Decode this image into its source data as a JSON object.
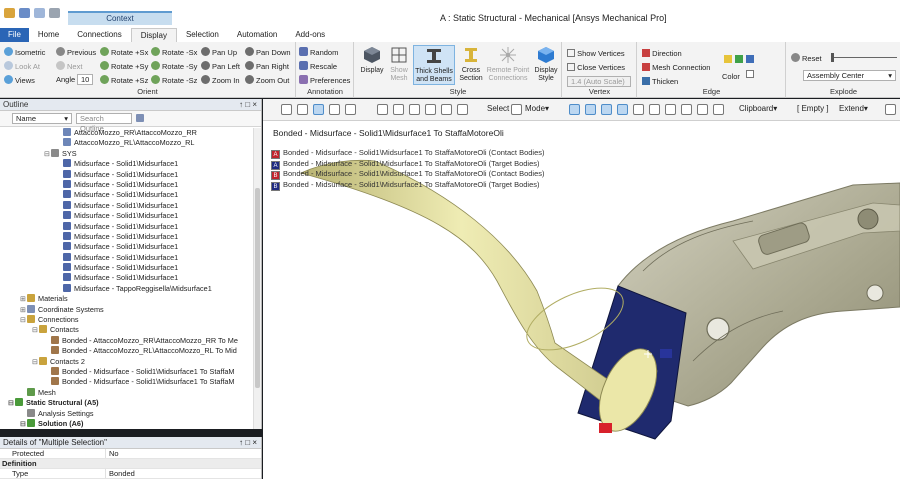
{
  "window": {
    "title": "A : Static Structural - Mechanical [Ansys Mechanical Pro]",
    "context_tab": "Context"
  },
  "tabs": [
    {
      "label": "File"
    },
    {
      "label": "Home"
    },
    {
      "label": "Connections"
    },
    {
      "label": "Display"
    },
    {
      "label": "Selection"
    },
    {
      "label": "Automation"
    },
    {
      "label": "Add-ons"
    }
  ],
  "ribbon": {
    "orient": {
      "label": "Orient",
      "isometric": "Isometric",
      "previous": "Previous",
      "next": "Next",
      "look_at": "Look At",
      "views": "Views",
      "angle_label": "Angle",
      "angle_value": "10",
      "rotate_px": "Rotate +Sx",
      "rotate_py": "Rotate +Sy",
      "rotate_pz": "Rotate +Sz",
      "rotate_mx": "Rotate -Sx",
      "rotate_my": "Rotate -Sy",
      "rotate_mz": "Rotate -Sz",
      "pan_up": "Pan Up",
      "pan_left": "Pan Left",
      "zoom_in": "Zoom In",
      "pan_down": "Pan Down",
      "pan_right": "Pan Right",
      "zoom_out": "Zoom Out"
    },
    "annotation": {
      "label": "Annotation",
      "random": "Random",
      "rescale": "Rescale",
      "preferences": "Preferences"
    },
    "style": {
      "label": "Style",
      "display": "Display",
      "show_mesh": [
        "Show",
        "Mesh"
      ],
      "thick_shells": [
        "Thick Shells",
        "and Beams"
      ],
      "cross_section": [
        "Cross",
        "Section"
      ],
      "remote_point": [
        "Remote Point",
        "Connections"
      ],
      "display_style": [
        "Display",
        "Style"
      ]
    },
    "vertex": {
      "label": "Vertex",
      "show_vertices": "Show Vertices",
      "close_vertices": "Close Vertices",
      "auto_scale": "1.4 (Auto Scale)"
    },
    "edge": {
      "label": "Edge",
      "direction": "Direction",
      "mesh_connection": "Mesh Connection",
      "thicken": "Thicken",
      "color": "Color"
    },
    "explode": {
      "label": "Explode",
      "reset": "Reset",
      "assembly_center": "Assembly Center"
    }
  },
  "outline": {
    "title": "Outline",
    "pin": "↑ □ ×",
    "name_select": "Name",
    "search_placeholder": "Search Outline",
    "rows": [
      {
        "indent": 4,
        "exp": "",
        "icon": "#6d86b8",
        "text": "AttaccoMozzo_RR\\AttaccoMozzo_RR",
        "bold": false
      },
      {
        "indent": 4,
        "exp": "",
        "icon": "#6d86b8",
        "text": "AttaccoMozzo_RL\\AttaccoMozzo_RL",
        "bold": false
      },
      {
        "indent": 3,
        "exp": "⊟",
        "icon": "#8a8a8a",
        "text": "SYS",
        "bold": false
      },
      {
        "indent": 4,
        "exp": "",
        "icon": "#4e67a8",
        "text": "Midsurface - Solid1\\Midsurface1",
        "bold": false
      },
      {
        "indent": 4,
        "exp": "",
        "icon": "#4e67a8",
        "text": "Midsurface - Solid1\\Midsurface1",
        "bold": false
      },
      {
        "indent": 4,
        "exp": "",
        "icon": "#4e67a8",
        "text": "Midsurface - Solid1\\Midsurface1",
        "bold": false
      },
      {
        "indent": 4,
        "exp": "",
        "icon": "#4e67a8",
        "text": "Midsurface - Solid1\\Midsurface1",
        "bold": false
      },
      {
        "indent": 4,
        "exp": "",
        "icon": "#4e67a8",
        "text": "Midsurface - Solid1\\Midsurface1",
        "bold": false
      },
      {
        "indent": 4,
        "exp": "",
        "icon": "#4e67a8",
        "text": "Midsurface - Solid1\\Midsurface1",
        "bold": false
      },
      {
        "indent": 4,
        "exp": "",
        "icon": "#4e67a8",
        "text": "Midsurface - Solid1\\Midsurface1",
        "bold": false
      },
      {
        "indent": 4,
        "exp": "",
        "icon": "#4e67a8",
        "text": "Midsurface - Solid1\\Midsurface1",
        "bold": false
      },
      {
        "indent": 4,
        "exp": "",
        "icon": "#4e67a8",
        "text": "Midsurface - Solid1\\Midsurface1",
        "bold": false
      },
      {
        "indent": 4,
        "exp": "",
        "icon": "#4e67a8",
        "text": "Midsurface - Solid1\\Midsurface1",
        "bold": false
      },
      {
        "indent": 4,
        "exp": "",
        "icon": "#4e67a8",
        "text": "Midsurface - Solid1\\Midsurface1",
        "bold": false
      },
      {
        "indent": 4,
        "exp": "",
        "icon": "#4e67a8",
        "text": "Midsurface - Solid1\\Midsurface1",
        "bold": false
      },
      {
        "indent": 4,
        "exp": "",
        "icon": "#4e67a8",
        "text": "Midsurface - TappoReggisella\\Midsurface1",
        "bold": false
      },
      {
        "indent": 1,
        "exp": "⊞",
        "icon": "#c9a33d",
        "text": "Materials",
        "bold": false
      },
      {
        "indent": 1,
        "exp": "⊞",
        "icon": "#7d8fb5",
        "text": "Coordinate Systems",
        "bold": false
      },
      {
        "indent": 1,
        "exp": "⊟",
        "icon": "#c9a33d",
        "text": "Connections",
        "bold": false
      },
      {
        "indent": 2,
        "exp": "⊟",
        "icon": "#c9a33d",
        "text": "Contacts",
        "bold": false
      },
      {
        "indent": 3,
        "exp": "",
        "icon": "#a0764a",
        "text": "Bonded - AttaccoMozzo_RR\\AttaccoMozzo_RR To Me",
        "bold": false
      },
      {
        "indent": 3,
        "exp": "",
        "icon": "#a0764a",
        "text": "Bonded - AttaccoMozzo_RL\\AttaccoMozzo_RL To Mid",
        "bold": false
      },
      {
        "indent": 2,
        "exp": "⊟",
        "icon": "#c9a33d",
        "text": "Contacts 2",
        "bold": false
      },
      {
        "indent": 3,
        "exp": "",
        "icon": "#a0764a",
        "text": "Bonded - Midsurface - Solid1\\Midsurface1 To StaffaM",
        "bold": false
      },
      {
        "indent": 3,
        "exp": "",
        "icon": "#a0764a",
        "text": "Bonded - Midsurface - Solid1\\Midsurface1 To StaffaM",
        "bold": false
      },
      {
        "indent": 1,
        "exp": "",
        "icon": "#5e9a4a",
        "text": "Mesh",
        "bold": false
      },
      {
        "indent": 0,
        "exp": "⊟",
        "icon": "#4a9a3a",
        "text": "Static Structural (A5)",
        "bold": true
      },
      {
        "indent": 1,
        "exp": "",
        "icon": "#8a8a8a",
        "text": "Analysis Settings",
        "bold": false
      },
      {
        "indent": 1,
        "exp": "⊟",
        "icon": "#4a9a3a",
        "text": "Solution (A6)",
        "bold": true
      },
      {
        "indent": 2,
        "exp": "",
        "icon": "#c9a33d",
        "text": "Solution Information",
        "bold": false
      }
    ]
  },
  "details": {
    "title": "Details of \"Multiple Selection\"",
    "pin": "↑ □ ×",
    "rows": [
      {
        "section": false,
        "key": "Protected",
        "value": "No"
      },
      {
        "section": true,
        "key": "Definition",
        "value": ""
      },
      {
        "section": false,
        "key": "Type",
        "value": "Bonded"
      }
    ]
  },
  "graphics_toolbar": {
    "select": "Select",
    "mode": "Mode▾",
    "clipboard": "Clipboard▾",
    "empty": "[ Empty ]",
    "extend": "Extend▾"
  },
  "viewport": {
    "title": "Bonded - Midsurface - Solid1\\Midsurface1 To StaffaMotoreOli",
    "legend": [
      {
        "letter": "A",
        "color": "#c0242d",
        "text": "Bonded - Midsurface - Solid1\\Midsurface1 To StaffaMotoreOli (Contact Bodies)"
      },
      {
        "letter": "A",
        "color": "#1f2a80",
        "text": "Bonded - Midsurface - Solid1\\Midsurface1 To StaffaMotoreOli (Target Bodies)"
      },
      {
        "letter": "B",
        "color": "#c0242d",
        "text": "Bonded - Midsurface - Solid1\\Midsurface1 To StaffaMotoreOli (Contact Bodies)"
      },
      {
        "letter": "B",
        "color": "#1f2a80",
        "text": "Bonded - Midsurface - Solid1\\Midsurface1 To StaffaMotoreOli (Target Bodies)"
      }
    ]
  },
  "colors": {
    "accent": "#2a65b6",
    "tube": "#e9e6a8",
    "target": "#1f2a6e",
    "bracket": "#b9b7a1",
    "contact": "#d8212b"
  }
}
